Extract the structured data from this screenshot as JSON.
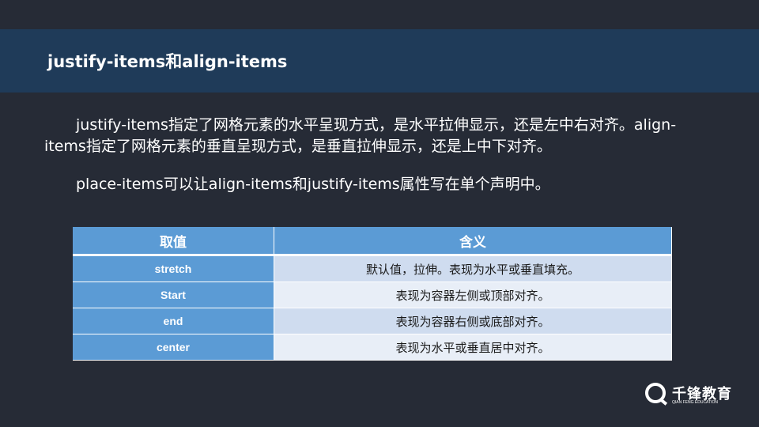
{
  "slide": {
    "title": "justify-items和align-items",
    "paragraph1": "justify-items指定了网格元素的水平呈现方式，是水平拉伸显示，还是左中右对齐。align-items指定了网格元素的垂直呈现方式，是垂直拉伸显示，还是上中下对齐。",
    "paragraph2": "place-items可以让align-items和justify-items属性写在单个声明中。"
  },
  "table": {
    "headers": [
      "取值",
      "含义"
    ],
    "rows": [
      {
        "key": "stretch",
        "value": "默认值，拉伸。表现为水平或垂直填充。"
      },
      {
        "key": "Start",
        "value": "表现为容器左侧或顶部对齐。"
      },
      {
        "key": "end",
        "value": "表现为容器右侧或底部对齐。"
      },
      {
        "key": "center",
        "value": "表现为水平或垂直居中对齐。"
      }
    ]
  },
  "logo": {
    "name_cn": "千锋教育",
    "name_en": "QIAN FENG EDUCATION"
  },
  "colors": {
    "background": "#262b36",
    "title_band": "#1f3b59",
    "table_accent": "#5b9bd5"
  }
}
